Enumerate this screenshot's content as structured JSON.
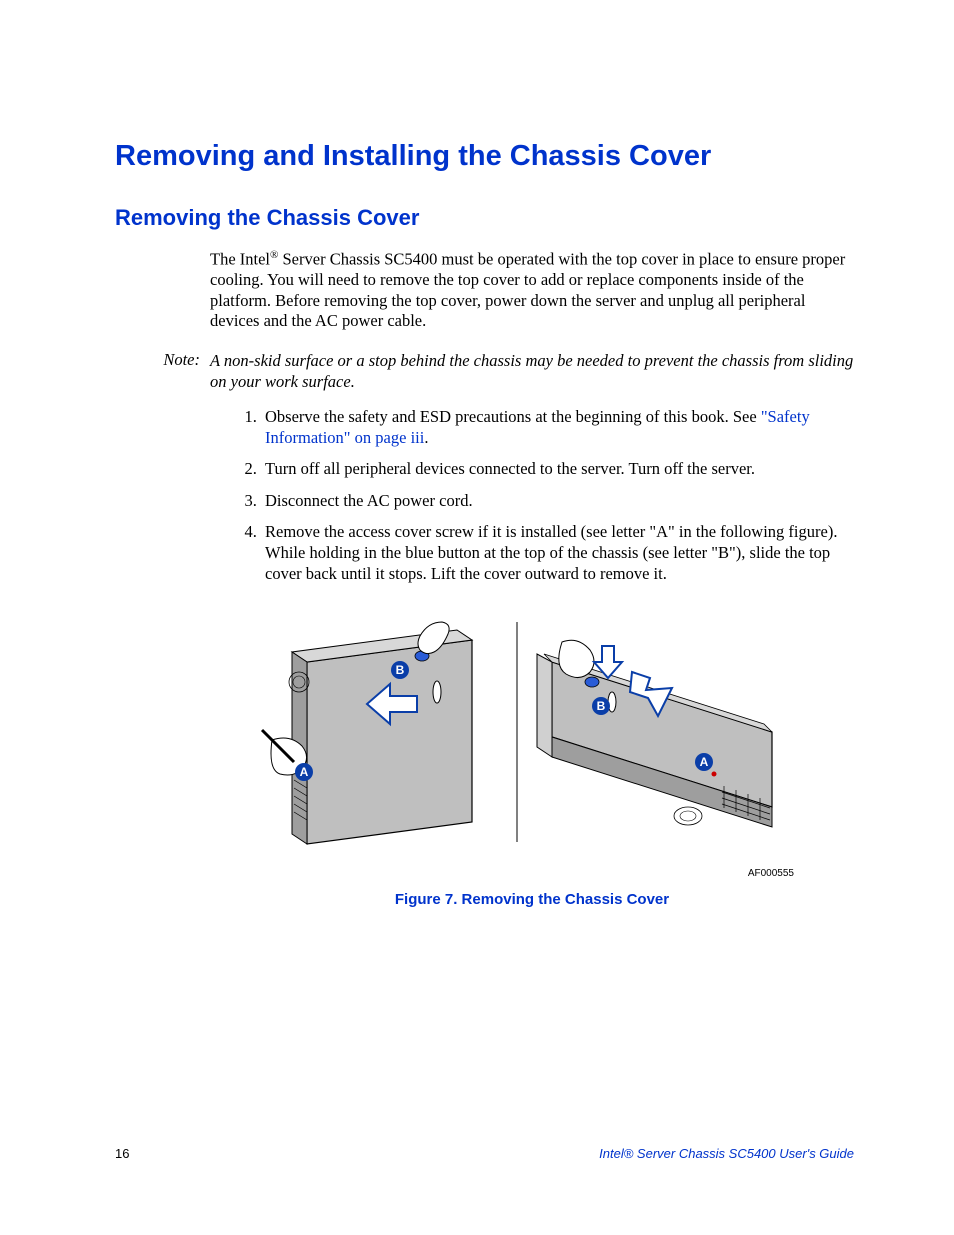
{
  "headings": {
    "h1": "Removing and Installing the Chassis Cover",
    "h2": "Removing the Chassis Cover"
  },
  "paragraphs": {
    "intro_pre": "The Intel",
    "intro_post": " Server Chassis SC5400 must be operated with the top cover in place to ensure proper cooling. You will need to remove the top cover to add or replace components inside of the platform. Before removing the top cover, power down the server and unplug all peripheral devices and the AC power cable."
  },
  "note": {
    "label": "Note:",
    "body": "A non-skid surface or a stop behind the chassis may be needed to prevent the chassis from sliding on your work surface."
  },
  "steps": {
    "s1_pre": "Observe the safety and ESD precautions at the beginning of this book. See ",
    "s1_link": "\"Safety Information\" on page iii",
    "s1_post": ".",
    "s2": "Turn off all peripheral devices connected to the server. Turn off the server.",
    "s3": "Disconnect the AC power cord.",
    "s4": "Remove the access cover screw if it is installed (see letter \"A\" in the following figure). While holding in the blue button at the top of the chassis (see letter \"B\"), slide the top cover back until it stops. Lift the cover outward to remove it."
  },
  "figure": {
    "id": "AF000555",
    "caption": "Figure 7. Removing the Chassis Cover",
    "callouts": {
      "a": "A",
      "b": "B"
    }
  },
  "footer": {
    "page": "16",
    "title": "Intel® Server Chassis SC5400 User's Guide"
  }
}
